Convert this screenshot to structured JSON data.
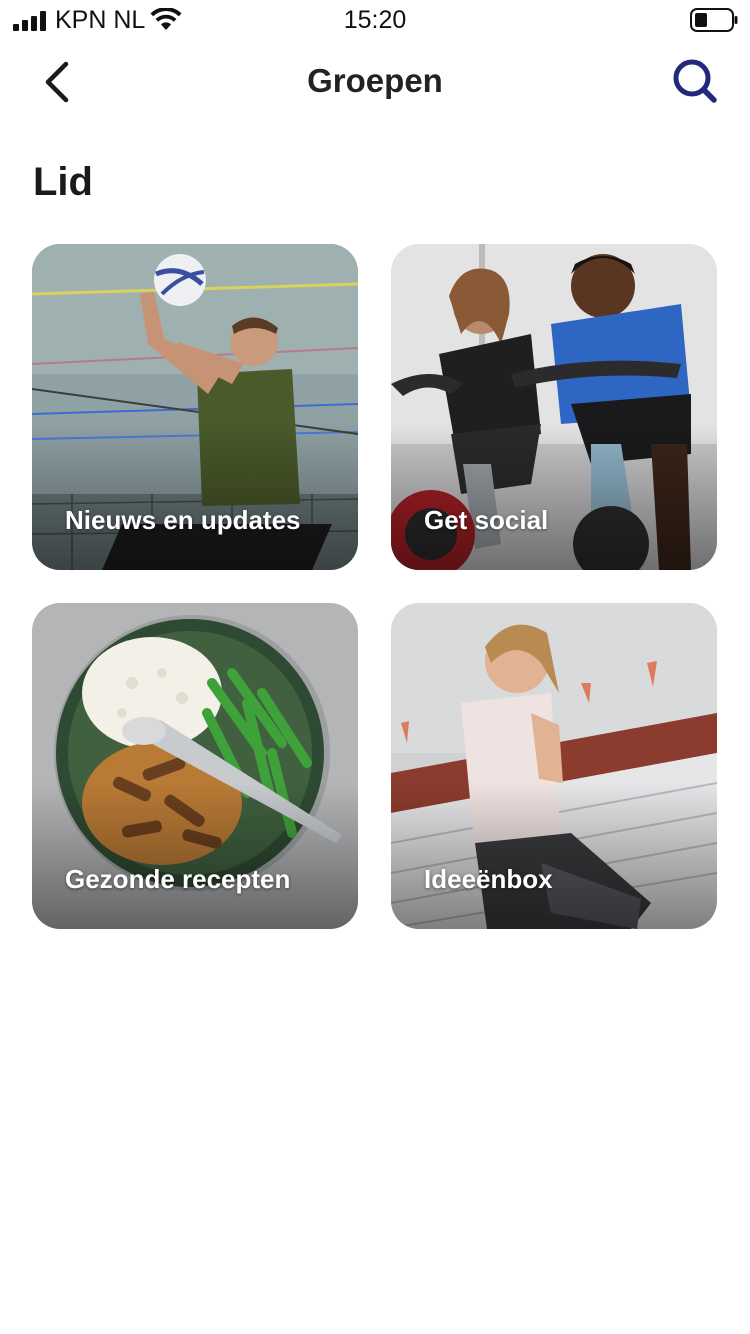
{
  "status_bar": {
    "carrier": "KPN NL",
    "time": "15:20"
  },
  "nav": {
    "title": "Groepen"
  },
  "section": {
    "title": "Lid"
  },
  "groups": [
    {
      "label": "Nieuws en updates"
    },
    {
      "label": "Get social"
    },
    {
      "label": "Gezonde recepten"
    },
    {
      "label": "Ideeënbox"
    }
  ],
  "colors": {
    "accent": "#23297a",
    "text": "#1a1a1a",
    "card_label": "#ffffff"
  },
  "icons": {
    "back": "chevron-left-icon",
    "search": "search-icon"
  }
}
